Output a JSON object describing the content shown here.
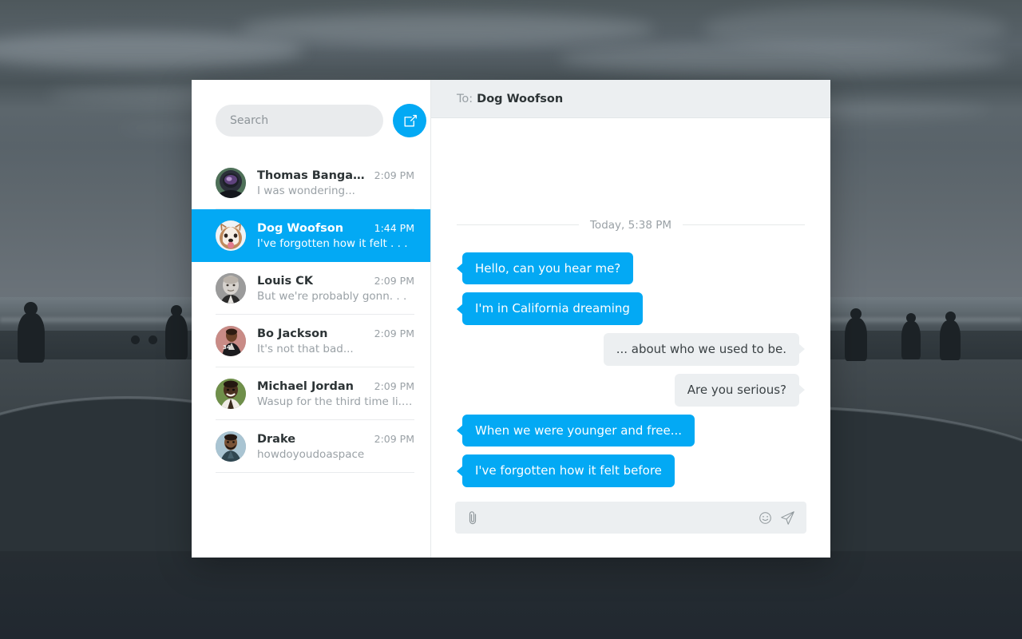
{
  "app": {
    "accent_color": "#03A9F4",
    "panel_bg": "#FFFFFF",
    "header_bg": "#ECEFF1",
    "muted_text_color": "#9AA1A6",
    "dark_text_color": "#2D3436"
  },
  "sidebar": {
    "search": {
      "placeholder": "Search",
      "value": ""
    },
    "compose_button": {
      "icon": "compose-icon",
      "label": "Compose"
    },
    "conversations": [
      {
        "name": "Thomas Bangalter",
        "time": "2:09 PM",
        "preview": "I was wondering...",
        "avatar": "daft-punk-helmet",
        "active": false
      },
      {
        "name": "Dog Woofson",
        "time": "1:44 PM",
        "preview": "I've forgotten how it felt . . .",
        "avatar": "husky-dog",
        "active": true
      },
      {
        "name": "Louis CK",
        "time": "2:09 PM",
        "preview": "But we're probably gonn. . .",
        "avatar": "louis-ck-portrait",
        "active": false
      },
      {
        "name": "Bo Jackson",
        "time": "2:09 PM",
        "preview": "It's not that bad...",
        "avatar": "bo-jackson-portrait",
        "active": false
      },
      {
        "name": "Michael Jordan",
        "time": "2:09 PM",
        "preview": "Wasup for the third time li. . .",
        "avatar": "michael-jordan-portrait",
        "active": false
      },
      {
        "name": "Drake",
        "time": "2:09 PM",
        "preview": "howdoyoudoaspace",
        "avatar": "drake-portrait",
        "active": false
      }
    ]
  },
  "chat": {
    "header": {
      "to_label": "To:",
      "recipient": "Dog Woofson"
    },
    "date_divider": "Today, 5:38 PM",
    "messages": [
      {
        "text": "Hello, can you hear me?",
        "direction": "in"
      },
      {
        "text": "I'm in California dreaming",
        "direction": "in"
      },
      {
        "text": "... about who we used to be.",
        "direction": "out"
      },
      {
        "text": "Are you serious?",
        "direction": "out"
      },
      {
        "text": "When we were younger and free...",
        "direction": "in"
      },
      {
        "text": "I've forgotten how it felt before",
        "direction": "in"
      }
    ],
    "composer": {
      "placeholder": "",
      "value": "",
      "attach_icon": "paperclip-icon",
      "emoji_icon": "smiley-icon",
      "send_icon": "paper-plane-icon"
    }
  }
}
